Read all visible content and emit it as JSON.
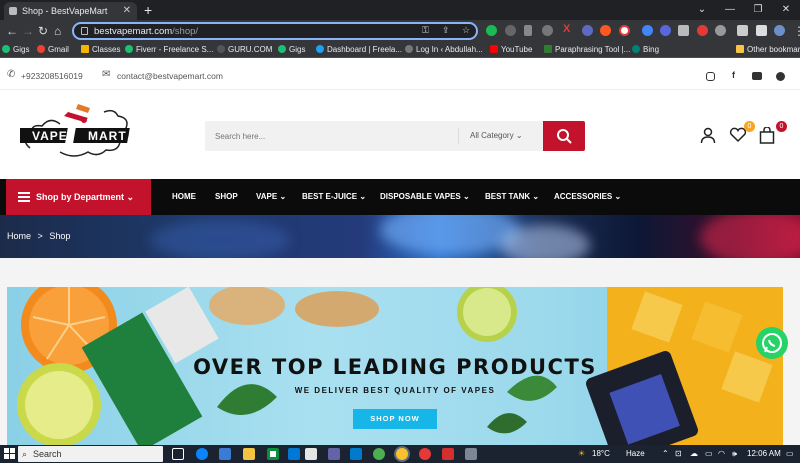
{
  "browser": {
    "tab_title": "Shop - BestVapeMart",
    "url_host": "bestvapemart.com",
    "url_path": "/shop/",
    "new_tab": "+",
    "bookmarks": [
      {
        "label": "Gigs",
        "color": "#1dbf73"
      },
      {
        "label": "Gmail",
        "color": "#ea4335"
      },
      {
        "label": "Classes",
        "color": "#f4b400"
      },
      {
        "label": "Fiverr - Freelance S...",
        "color": "#1dbf73"
      },
      {
        "label": "GURU.COM",
        "color": "#555555"
      },
      {
        "label": "Gigs",
        "color": "#1dbf73"
      },
      {
        "label": "Dashboard | Freela...",
        "color": "#1da1f2"
      },
      {
        "label": "Log In ‹ Abdullah...",
        "color": "#777777"
      },
      {
        "label": "YouTube",
        "color": "#ff0000"
      },
      {
        "label": "Paraphrasing Tool |...",
        "color": "#2e7d32"
      },
      {
        "label": "Bing",
        "color": "#008373"
      },
      {
        "label": "Other bookmarks",
        "color": "#f6c343"
      }
    ]
  },
  "contact": {
    "phone": "+923208516019",
    "email": "contact@bestvapemart.com"
  },
  "logo": {
    "word1": "VAPE",
    "word2": "MART"
  },
  "search": {
    "placeholder": "Search here...",
    "category": "All Category"
  },
  "header_icons": {
    "wishlist_count": "0",
    "cart_count": "0"
  },
  "nav": {
    "department": "Shop by Department",
    "items": [
      "HOME",
      "SHOP",
      "VAPE",
      "BEST E-JUICE",
      "DISPOSABLE VAPES",
      "BEST TANK",
      "ACCESSORIES"
    ]
  },
  "breadcrumb": {
    "home": "Home",
    "separator": ">",
    "current": "Shop"
  },
  "hero": {
    "title": "OVER TOP LEADING PRODUCTS",
    "subtitle": "WE DELIVER BEST QUALITY OF VAPES",
    "button": "SHOP NOW"
  },
  "taskbar": {
    "search": "Search",
    "temperature": "18°C",
    "weather": "Haze",
    "time": "12:06 AM"
  },
  "colors": {
    "accent_red": "#c3122b",
    "nav_black": "#0b0b0b",
    "button_cyan": "#17b6e8",
    "whatsapp_green": "#25d366",
    "badge_orange": "#f5a623"
  }
}
